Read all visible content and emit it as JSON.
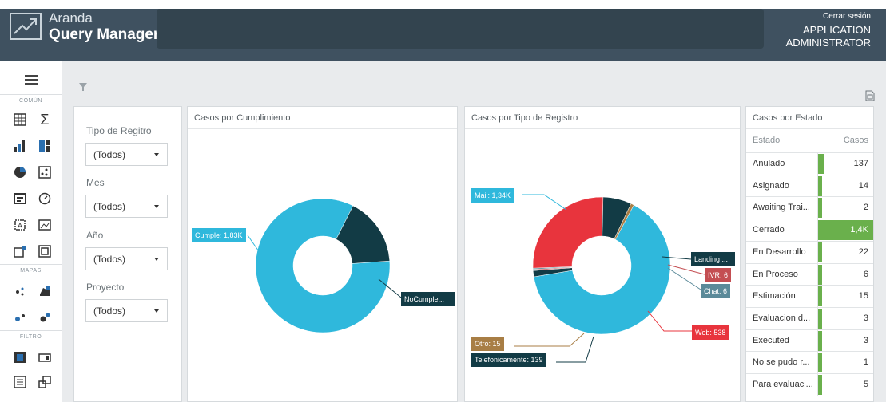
{
  "header": {
    "brand_line1": "Aranda",
    "brand_line2": "Query Manager",
    "logout": "Cerrar sesión",
    "user_line1": "APPLICATION",
    "user_line2": "ADMINISTRATOR"
  },
  "sidebar": {
    "sections": [
      "COMÚN",
      "MAPAS",
      "FILTRO"
    ],
    "icons": [
      "grid-icon",
      "sigma-icon",
      "bar-chart-icon",
      "treemap-icon",
      "pie-chart-icon",
      "scatter-icon",
      "card-icon",
      "gauge-icon",
      "text-box-icon",
      "image-icon",
      "chart-image-icon",
      "group-icon",
      "dot-map-icon",
      "filled-map-icon",
      "bubble-map-icon",
      "pie-map-icon",
      "range-filter-icon",
      "combo-filter-icon",
      "list-filter-icon",
      "tree-filter-icon"
    ]
  },
  "filters": {
    "f1_label": "Tipo de Regitro",
    "f1_value": "(Todos)",
    "f2_label": "Mes",
    "f2_value": "(Todos)",
    "f3_label": "Año",
    "f3_value": "(Todos)",
    "f4_label": "Proyecto",
    "f4_value": "(Todos)"
  },
  "panels": {
    "cumplimiento_title": "Casos por Cumplimiento",
    "tipo_title": "Casos por Tipo de Registro",
    "estado_title": "Casos por Estado"
  },
  "colors": {
    "teal": "#2fb8dc",
    "dark": "#123b45",
    "red": "#e8343d",
    "brown": "#a87e45",
    "green": "#6ab04c",
    "header": "#3f5160"
  },
  "chart_data": [
    {
      "type": "pie",
      "title": "Casos por Cumplimiento",
      "labels": [
        "Cumple",
        "NoCumple..."
      ],
      "values": [
        1830,
        360
      ],
      "data_labels": [
        "Cumple: 1,83K",
        "NoCumple..."
      ],
      "colors": [
        "#2fb8dc",
        "#123b45"
      ],
      "donut": true
    },
    {
      "type": "pie",
      "title": "Casos por Tipo de Registro",
      "labels": [
        "Mail",
        "Landing ...",
        "IVR",
        "Chat",
        "Web",
        "Telefonicamente",
        "Otro"
      ],
      "values": [
        1340,
        30,
        6,
        6,
        538,
        139,
        15
      ],
      "data_labels": [
        "Mail: 1,34K",
        "Landing ...",
        "IVR: 6",
        "Chat: 6",
        "Web: 538",
        "Telefonicamente: 139",
        "Otro: 15"
      ],
      "colors": [
        "#2fb8dc",
        "#123b45",
        "#c44e52",
        "#5b8a99",
        "#e8343d",
        "#123b45",
        "#a87e45"
      ],
      "donut": true
    },
    {
      "type": "table",
      "title": "Casos por Estado",
      "columns": [
        "Estado",
        "Casos"
      ],
      "rows": [
        [
          "Anulado",
          "137"
        ],
        [
          "Asignado",
          "14"
        ],
        [
          "Awaiting Trai...",
          "2"
        ],
        [
          "Cerrado",
          "1,4K"
        ],
        [
          "En Desarrollo",
          "22"
        ],
        [
          "En Proceso",
          "6"
        ],
        [
          "Estimación",
          "15"
        ],
        [
          "Evaluacion d...",
          "3"
        ],
        [
          "Executed",
          "3"
        ],
        [
          "No se pudo r...",
          "1"
        ],
        [
          "Para evaluaci...",
          "5"
        ]
      ],
      "values": [
        137,
        14,
        2,
        1400,
        22,
        6,
        15,
        3,
        3,
        1,
        5
      ]
    }
  ]
}
